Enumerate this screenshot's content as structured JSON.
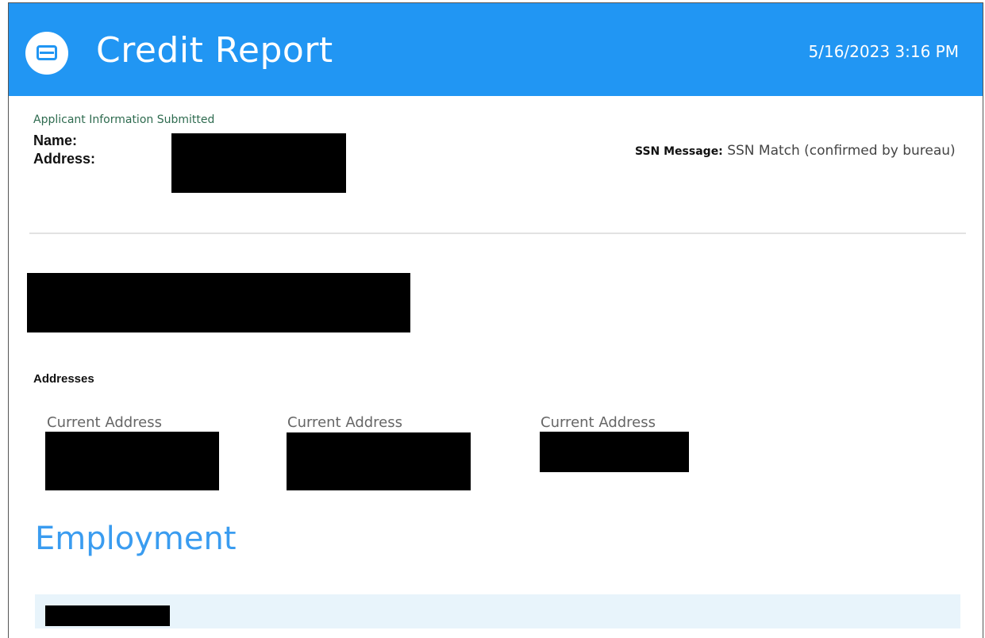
{
  "header": {
    "title": "Credit Report",
    "timestamp": "5/16/2023 3:16 PM",
    "logo_icon": "credit-card-icon",
    "background_color": "#2196f3"
  },
  "applicant": {
    "heading": "Applicant Information Submitted",
    "name_label": "Name:",
    "address_label": "Address:",
    "ssn_label": "SSN Message:",
    "ssn_value": " SSN Match (confirmed by bureau)"
  },
  "addresses": {
    "heading": "Addresses",
    "items": [
      {
        "label": "Current Address"
      },
      {
        "label": "Current Address"
      },
      {
        "label": "Current Address"
      }
    ]
  },
  "employment": {
    "heading": "Employment",
    "accent_color": "#3a9cf0"
  }
}
